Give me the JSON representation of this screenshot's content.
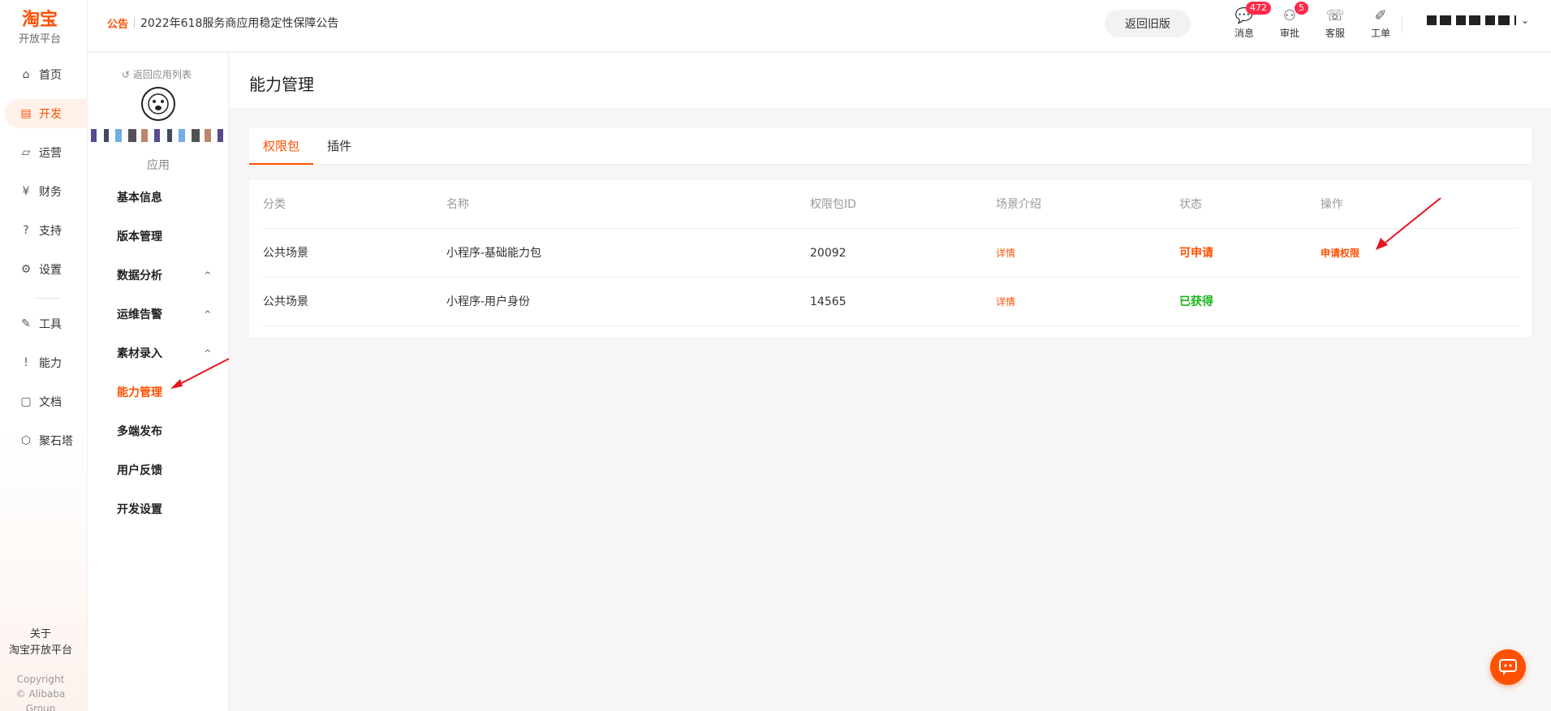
{
  "brand": {
    "name": "淘宝",
    "subtitle": "开放平台"
  },
  "gnav": {
    "items": [
      {
        "label": "首页",
        "icon": "⌂"
      },
      {
        "label": "开发",
        "icon": "▤"
      },
      {
        "label": "运营",
        "icon": "▱"
      },
      {
        "label": "财务",
        "icon": "¥"
      },
      {
        "label": "支持",
        "icon": "?"
      },
      {
        "label": "设置",
        "icon": "⚙"
      },
      {
        "label": "工具",
        "icon": "✎"
      },
      {
        "label": "能力",
        "icon": "!"
      },
      {
        "label": "文档",
        "icon": "▢"
      },
      {
        "label": "聚石塔",
        "icon": "⬡"
      }
    ],
    "about_line1": "关于",
    "about_line2": "淘宝开放平台",
    "copyright_line1": "Copyright",
    "copyright_line2": "© Alibaba Group"
  },
  "topbar": {
    "notice_tag": "公告",
    "notice_text": "2022年618服务商应用稳定性保障公告",
    "old_version_label": "返回旧版",
    "tools": [
      {
        "label": "消息",
        "icon": "💬",
        "badge": "472"
      },
      {
        "label": "审批",
        "icon": "⚇",
        "badge": "5"
      },
      {
        "label": "客服",
        "icon": "☏",
        "badge": ""
      },
      {
        "label": "工单",
        "icon": "✐",
        "badge": ""
      }
    ],
    "user_caret": "⌄"
  },
  "snav": {
    "back_label": "↺ 返回应用列表",
    "app_type": "应用",
    "items": [
      {
        "label": "基本信息",
        "caret": ""
      },
      {
        "label": "版本管理",
        "caret": ""
      },
      {
        "label": "数据分析",
        "caret": "^"
      },
      {
        "label": "运维告警",
        "caret": "^"
      },
      {
        "label": "素材录入",
        "caret": "^"
      },
      {
        "label": "能力管理",
        "caret": ""
      },
      {
        "label": "多端发布",
        "caret": ""
      },
      {
        "label": "用户反馈",
        "caret": ""
      },
      {
        "label": "开发设置",
        "caret": ""
      }
    ]
  },
  "main": {
    "title": "能力管理",
    "tabs": [
      "权限包",
      "插件"
    ],
    "columns": [
      "分类",
      "名称",
      "权限包ID",
      "场景介绍",
      "状态",
      "操作"
    ],
    "rows": [
      {
        "category": "公共场景",
        "name": "小程序-基础能力包",
        "id": "20092",
        "intro": "详情",
        "status": "可申请",
        "action": "申请权限"
      },
      {
        "category": "公共场景",
        "name": "小程序-用户身份",
        "id": "14565",
        "intro": "详情",
        "status": "已获得",
        "action": ""
      }
    ]
  },
  "colors": {
    "accent": "#ff5000",
    "success": "#19b31a",
    "badge": "#ff2a4a",
    "annotation": "#e8141e"
  }
}
